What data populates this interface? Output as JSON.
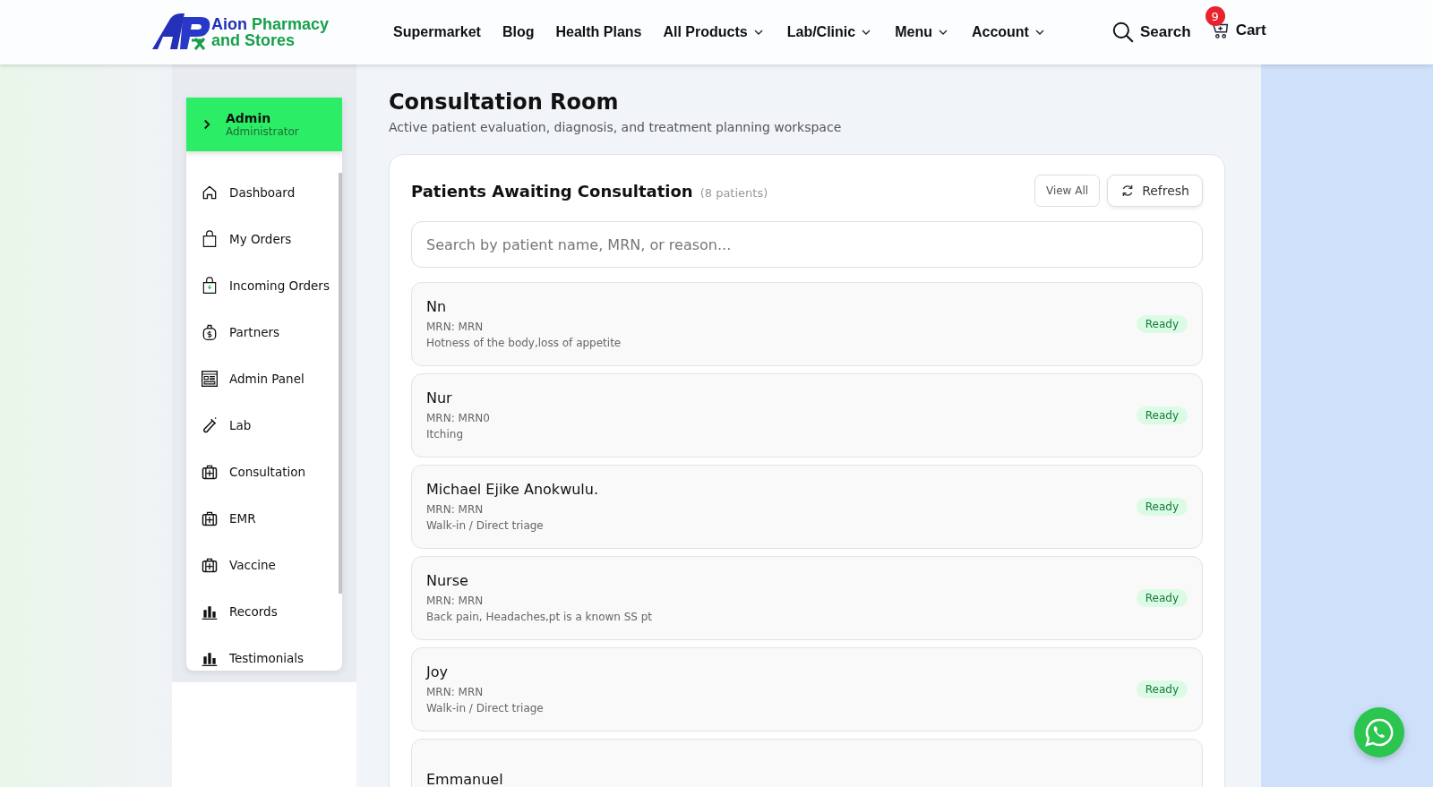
{
  "header": {
    "logo": {
      "line1_a": "Aion",
      "line1_b": "Pharmacy",
      "line2": "and Stores"
    },
    "nav": [
      {
        "label": "Supermarket",
        "dropdown": false
      },
      {
        "label": "Blog",
        "dropdown": false
      },
      {
        "label": "Health Plans",
        "dropdown": false
      },
      {
        "label": "All Products",
        "dropdown": true
      },
      {
        "label": "Lab/Clinic",
        "dropdown": true
      },
      {
        "label": "Menu",
        "dropdown": true
      },
      {
        "label": "Account",
        "dropdown": true
      }
    ],
    "search": "Search",
    "cart": {
      "label": "Cart",
      "count": "9"
    }
  },
  "sidebar": {
    "user": {
      "name": "Admin",
      "role": "Administrator"
    },
    "items": [
      {
        "label": "Dashboard"
      },
      {
        "label": "My Orders"
      },
      {
        "label": "Incoming Orders"
      },
      {
        "label": "Partners"
      },
      {
        "label": "Admin Panel"
      },
      {
        "label": "Lab"
      },
      {
        "label": "Consultation"
      },
      {
        "label": "EMR"
      },
      {
        "label": "Vaccine"
      },
      {
        "label": "Records"
      },
      {
        "label": "Testimonials"
      }
    ]
  },
  "page": {
    "title": "Consultation Room",
    "subtitle": "Active patient evaluation, diagnosis, and treatment planning workspace"
  },
  "panel": {
    "title": "Patients Awaiting Consultation",
    "count": "(8 patients)",
    "view_all": "View All",
    "refresh": "Refresh",
    "search_placeholder": "Search by patient name, MRN, or reason...",
    "patients": [
      {
        "name": "Nn",
        "mrn": "MRN: MRN",
        "reason": "Hotness of the body,loss of appetite",
        "status": "Ready"
      },
      {
        "name": "Nur",
        "mrn": "MRN: MRN0",
        "reason": "Itching",
        "status": "Ready"
      },
      {
        "name": "Michael Ejike Anokwulu.",
        "mrn": "MRN: MRN",
        "reason": "Walk-in / Direct triage",
        "status": "Ready"
      },
      {
        "name": "Nurse",
        "mrn": "MRN: MRN",
        "reason": "Back pain, Headaches,pt is a known SS pt",
        "status": "Ready"
      },
      {
        "name": "Joy",
        "mrn": "MRN: MRN",
        "reason": "Walk-in / Direct triage",
        "status": "Ready"
      },
      {
        "name": "Emmanuel"
      }
    ]
  }
}
